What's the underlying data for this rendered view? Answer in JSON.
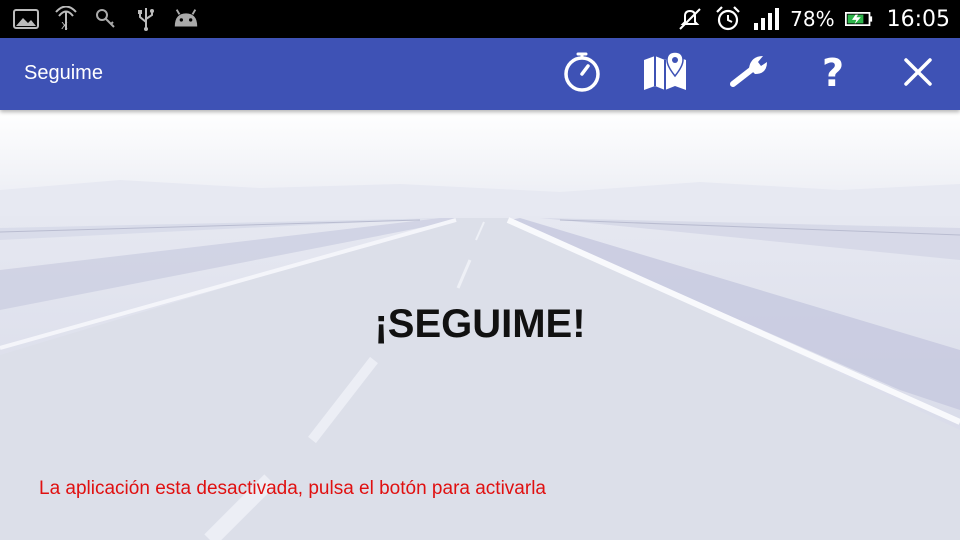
{
  "status_bar": {
    "left_icons": [
      "image-icon",
      "sim-signal-x-icon",
      "key-icon",
      "usb-icon",
      "android-icon"
    ],
    "battery_percent": "78%",
    "time": "16:05"
  },
  "app_bar": {
    "title": "Seguime",
    "actions": [
      "timer-icon",
      "map-icon",
      "wrench-icon",
      "help-icon",
      "close-icon"
    ],
    "color": "#3e52b5"
  },
  "main": {
    "headline": "¡SEGUIME!",
    "status_message": "La aplicación esta desactivada, pulsa el botón para activarla",
    "message_color": "#e01010"
  }
}
